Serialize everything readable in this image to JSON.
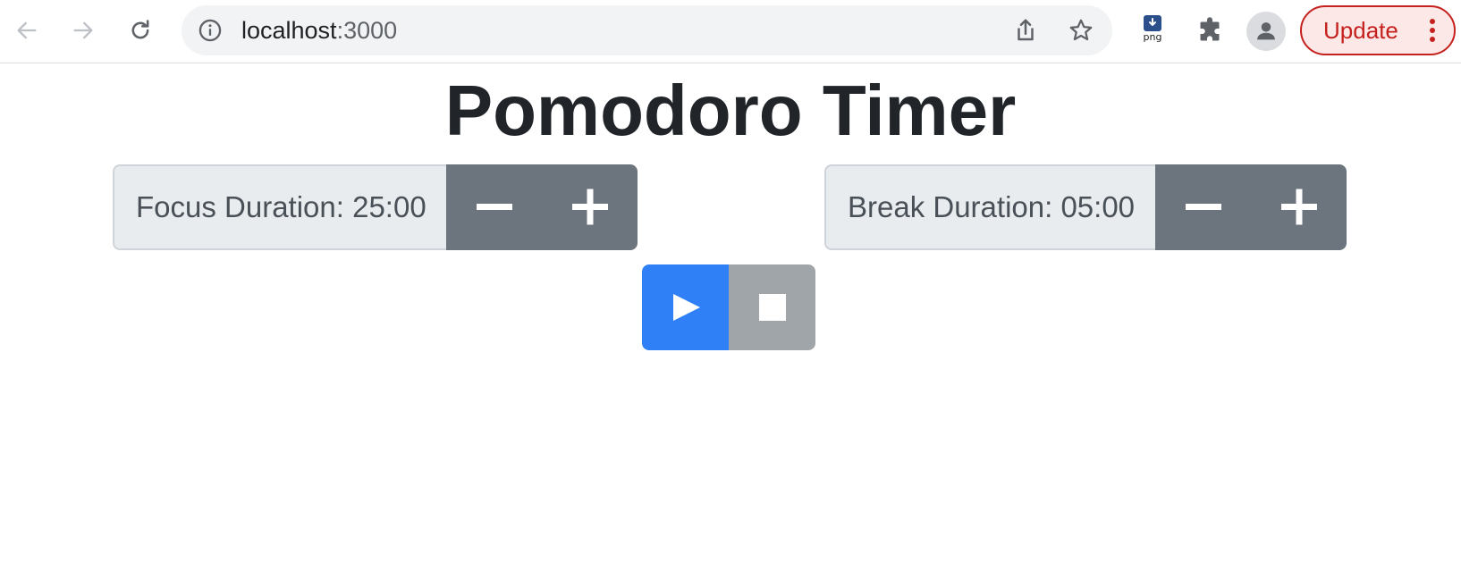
{
  "browser": {
    "url_host": "localhost",
    "url_port": ":3000",
    "update_label": "Update",
    "extension_label": "png",
    "icons": {
      "back": "arrow-left-icon",
      "forward": "arrow-right-icon",
      "reload": "reload-icon",
      "site_info": "info-icon",
      "share": "share-icon",
      "bookmark": "star-icon",
      "extension": "png-download-icon",
      "extensions_menu": "puzzle-icon",
      "profile": "person-icon",
      "menu": "kebab-menu-icon"
    },
    "colors": {
      "update_accent": "#c5221f",
      "update_bg": "#fce8e6"
    }
  },
  "app": {
    "title": "Pomodoro Timer",
    "focus": {
      "label": "Focus Duration: 25:00",
      "decrement_icon": "minus-icon",
      "increment_icon": "plus-icon"
    },
    "break": {
      "label": "Break Duration: 05:00",
      "decrement_icon": "minus-icon",
      "increment_icon": "plus-icon"
    },
    "controls": {
      "play_icon": "play-icon",
      "stop_icon": "stop-icon"
    },
    "colors": {
      "primary": "#2f80f7",
      "secondary": "#6c757d",
      "stop_disabled": "#a0a5aa",
      "label_bg": "#e9ecef",
      "title_text": "#212529"
    }
  }
}
